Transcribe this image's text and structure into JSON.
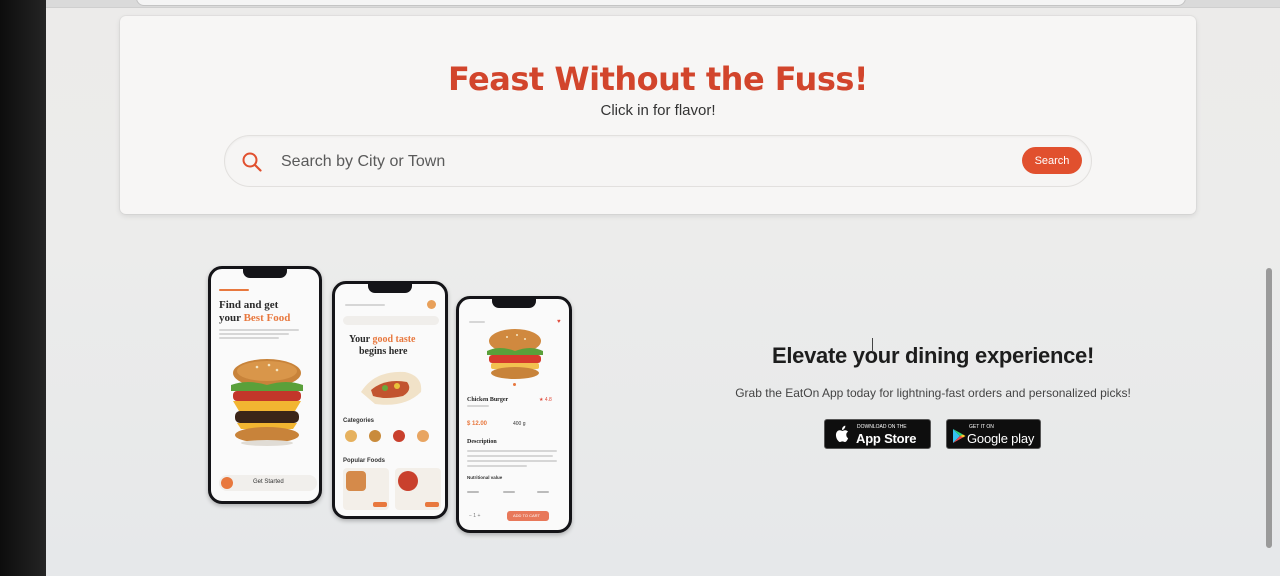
{
  "hero": {
    "title": "Feast Without the Fuss!",
    "subtitle": "Click in for flavor!",
    "search": {
      "placeholder": "Search by City or Town",
      "button_label": "Search"
    }
  },
  "phones": {
    "onboarding": {
      "heading_line1": "Find and get",
      "heading_line2_prefix": "your ",
      "heading_line2_accent": "Best Food",
      "button_label": "Get Started"
    },
    "home": {
      "heading_line1_prefix": "Your ",
      "heading_line1_accent": "good taste",
      "heading_line2": "begins here",
      "categories_label": "Categories",
      "popular_label": "Popular Foods"
    },
    "detail": {
      "item_name": "Chicken Burger",
      "price": "$ 12.00",
      "weight": "400 g",
      "description_label": "Description",
      "nutrition_label": "Nutritional value",
      "add_button": "ADD TO CART"
    }
  },
  "app_promo": {
    "title": "Elevate your dining experience!",
    "subtitle": "Grab the EatOn App today for lightning-fast orders and personalized picks!",
    "app_store": {
      "small": "Download on the",
      "big": "App Store"
    },
    "google_play": {
      "small": "GET IT ON",
      "big": "Google play"
    }
  },
  "colors": {
    "brand": "#d2452c",
    "button": "#e1502e",
    "accent": "#e8783e"
  }
}
